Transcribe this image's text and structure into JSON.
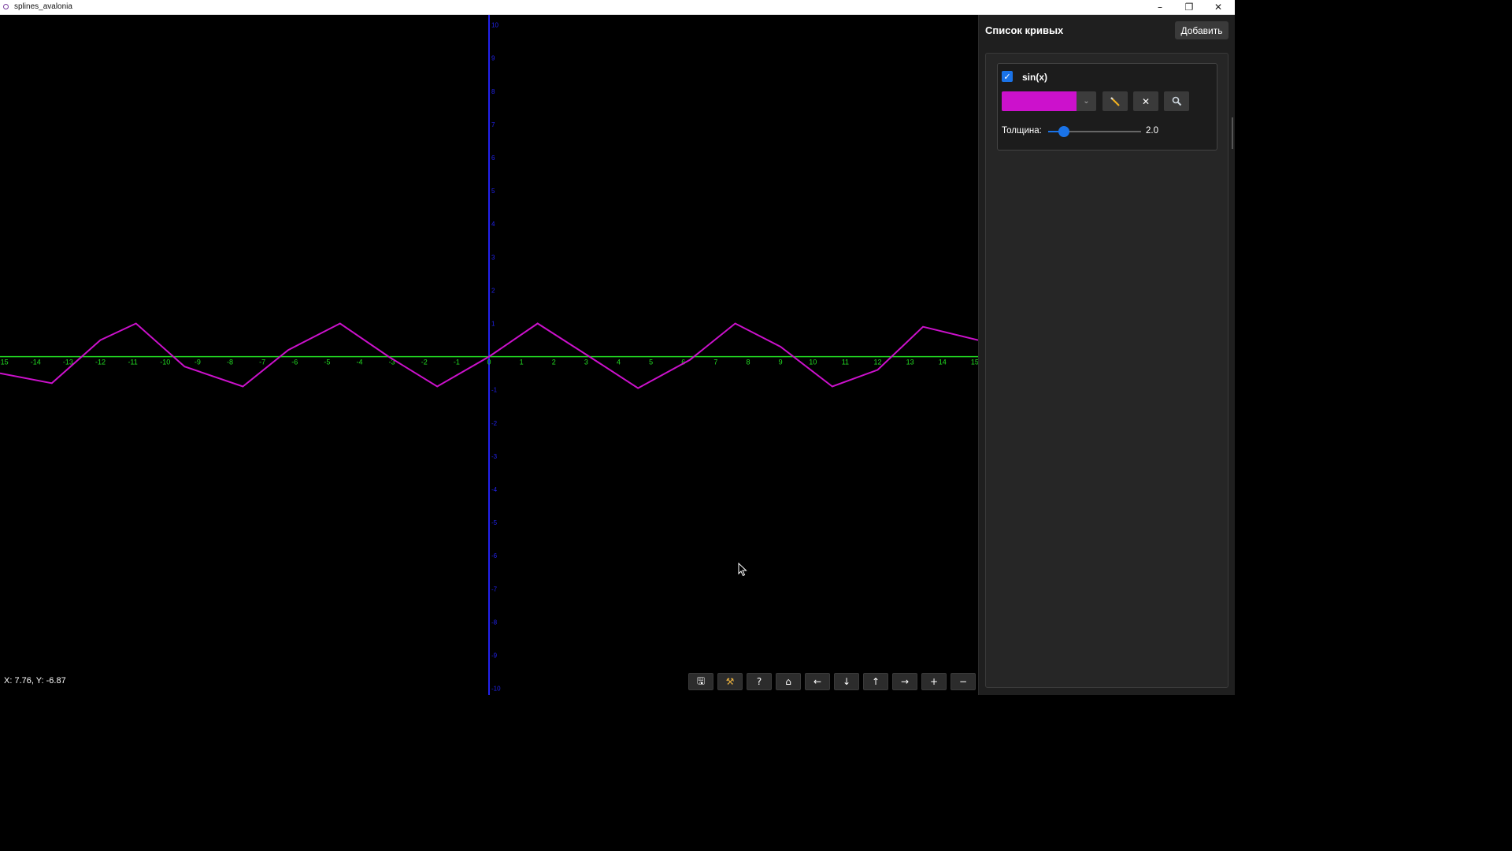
{
  "window": {
    "title": "splines_avalonia",
    "minimize_icon": "minimize-icon",
    "maximize_icon": "restore-icon",
    "close_icon": "close-icon"
  },
  "plot": {
    "background": "#000000",
    "x_axis_color": "#22dd22",
    "y_axis_color": "#2222ee",
    "x_ticks": [
      "-15",
      "-14",
      "-13",
      "-12",
      "-11",
      "-10",
      "-9",
      "-8",
      "-7",
      "-6",
      "-5",
      "-4",
      "-3",
      "-2",
      "-1",
      "0",
      "1",
      "2",
      "3",
      "4",
      "5",
      "6",
      "7",
      "8",
      "9",
      "10",
      "11",
      "12",
      "13",
      "14",
      "15"
    ],
    "y_ticks": [
      "10",
      "9",
      "8",
      "7",
      "6",
      "5",
      "4",
      "3",
      "2",
      "1",
      "-1",
      "-2",
      "-3",
      "-4",
      "-5",
      "-6",
      "-7",
      "-8",
      "-9",
      "-10"
    ],
    "x_range": [
      -15.1,
      15.1
    ],
    "y_range": [
      -10.2,
      10.3
    ]
  },
  "chart_data": {
    "type": "line",
    "title": "",
    "xlabel": "",
    "ylabel": "",
    "xlim": [
      -15,
      15
    ],
    "ylim": [
      -10,
      10
    ],
    "grid": false,
    "series": [
      {
        "name": "sin(x)",
        "color": "#cc11cc",
        "x": [
          -15.1,
          -13.5,
          -12.0,
          -10.9,
          -9.4,
          -7.6,
          -6.2,
          -4.6,
          -3.1,
          -1.6,
          0.0,
          1.5,
          3.1,
          4.6,
          6.2,
          7.6,
          9.0,
          10.6,
          12.0,
          13.4,
          15.1
        ],
        "y": [
          -0.5,
          -0.8,
          0.5,
          1.0,
          -0.3,
          -0.9,
          0.2,
          1.0,
          0.0,
          -0.9,
          0.0,
          1.0,
          0.0,
          -0.95,
          -0.1,
          1.0,
          0.3,
          -0.9,
          -0.4,
          0.9,
          0.5
        ]
      }
    ]
  },
  "status": {
    "coords": "X: 7.76, Y: -6.87"
  },
  "toolbar": {
    "buttons": [
      {
        "name": "save-button",
        "icon": "save-icon",
        "glyph": "🖫"
      },
      {
        "name": "tools-button",
        "icon": "tools-icon",
        "glyph": "⚒"
      },
      {
        "name": "help-button",
        "icon": "help-icon",
        "glyph": "?"
      },
      {
        "name": "home-button",
        "icon": "home-icon",
        "glyph": "⌂"
      },
      {
        "name": "pan-left-button",
        "icon": "arrow-left-icon",
        "glyph": "←"
      },
      {
        "name": "pan-down-button",
        "icon": "arrow-down-icon",
        "glyph": "↓"
      },
      {
        "name": "pan-up-button",
        "icon": "arrow-up-icon",
        "glyph": "↑"
      },
      {
        "name": "pan-right-button",
        "icon": "arrow-right-icon",
        "glyph": "→"
      },
      {
        "name": "zoom-in-button",
        "icon": "plus-icon",
        "glyph": "+"
      },
      {
        "name": "zoom-out-button",
        "icon": "minus-icon",
        "glyph": "−"
      }
    ]
  },
  "sidebar": {
    "title": "Список кривых",
    "add_label": "Добавить",
    "curves": [
      {
        "name": "sin(x)",
        "visible": true,
        "color": "#cc11cc",
        "thickness_label": "Толщина:",
        "thickness_value": "2.0",
        "thickness_fraction": 0.17,
        "edit_icon": "pencil-icon",
        "delete_icon": "close-icon",
        "zoom_icon": "magnifier-icon"
      }
    ]
  }
}
